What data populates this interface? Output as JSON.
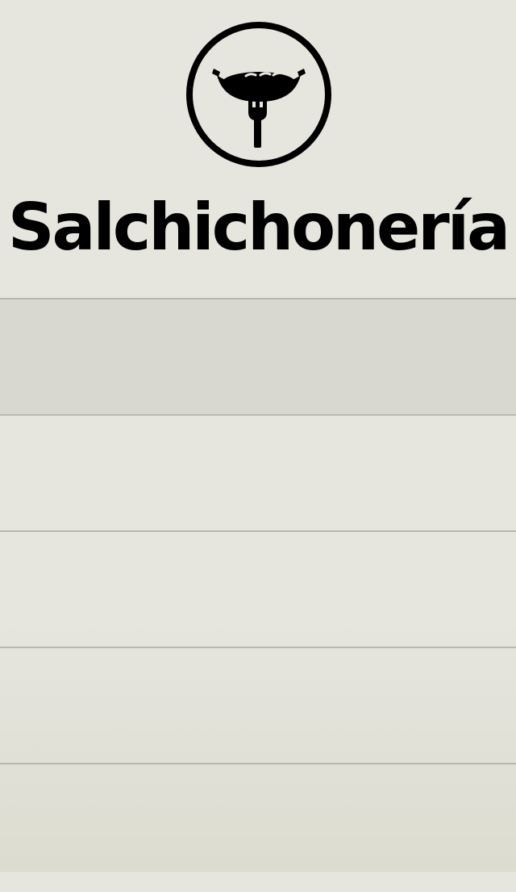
{
  "app": {
    "title": "Salchichonería",
    "logo_icon": "sausage-on-fork-icon"
  },
  "menu": {
    "items": [
      {
        "label": ""
      },
      {
        "label": ""
      },
      {
        "label": ""
      },
      {
        "label": ""
      },
      {
        "label": ""
      }
    ]
  },
  "colors": {
    "background": "#e6e6df",
    "selected_row": "#d8d8d1",
    "divider": "#b8b8b0",
    "text": "#000000"
  }
}
